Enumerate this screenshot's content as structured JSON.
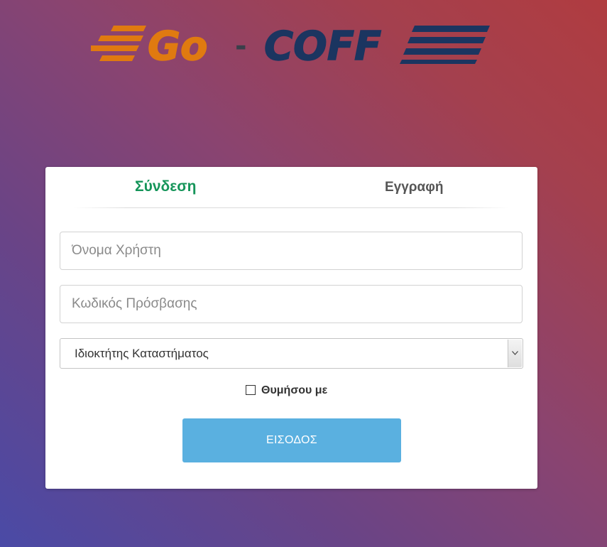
{
  "brand": {
    "name_part1": "Go",
    "separator": "-",
    "name_part2": "COFF",
    "color_go": "#e07a10",
    "color_coffee": "#1b3560"
  },
  "tabs": [
    {
      "label": "Σύνδεση",
      "active": true
    },
    {
      "label": "Εγγραφή",
      "active": false
    }
  ],
  "form": {
    "username_placeholder": "Όνομα Χρήστη",
    "username_value": "",
    "password_placeholder": "Κωδικός Πρόσβασης",
    "password_value": "",
    "role_selected": "Ιδιοκτήτης Καταστήματος",
    "remember_label": "Θυμήσου με",
    "remember_checked": false,
    "submit_label": "ΕΙΣΟΔΟΣ"
  },
  "colors": {
    "active_tab": "#16955a",
    "submit_button": "#5ab0e0"
  }
}
